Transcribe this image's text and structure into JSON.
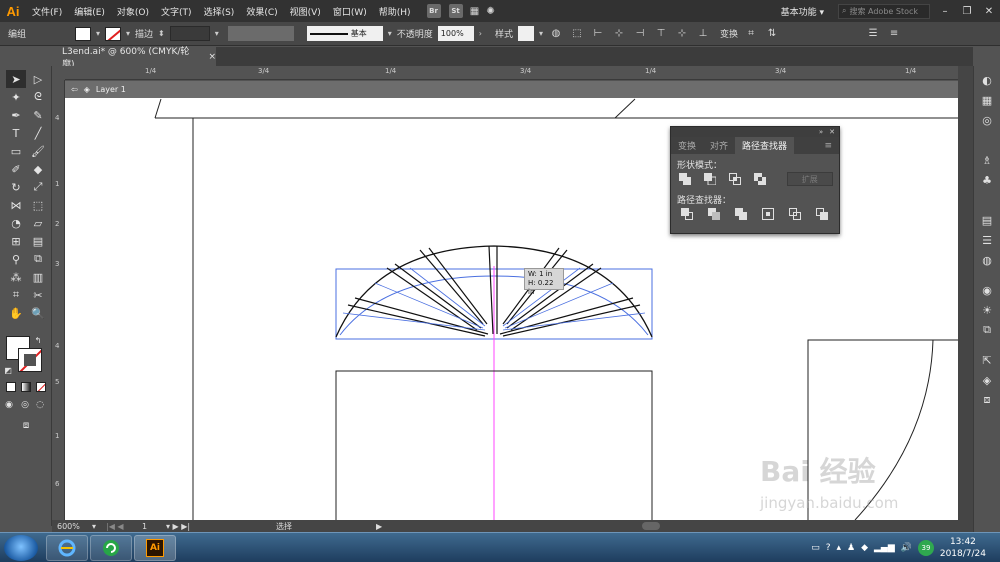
{
  "app": {
    "logo": "Ai",
    "workspace": "基本功能",
    "search_placeholder": "搜索 Adobe Stock"
  },
  "menu": [
    "文件(F)",
    "编辑(E)",
    "对象(O)",
    "文字(T)",
    "选择(S)",
    "效果(C)",
    "视图(V)",
    "窗口(W)",
    "帮助(H)"
  ],
  "menu_badges": [
    "Br",
    "St"
  ],
  "control": {
    "group_label": "编组",
    "stroke_label": "描边",
    "stroke_style": "基本",
    "opacity_label": "不透明度",
    "opacity_value": "100%",
    "style_label": "样式",
    "transform_label": "变换"
  },
  "document": {
    "tab_title": "L3end.ai* @ 600% (CMYK/轮廓)",
    "close": "×"
  },
  "layer": {
    "name": "Layer 1"
  },
  "ruler": {
    "top_labels": [
      "1/4",
      "1/4",
      "3/4",
      "1/4",
      "3/4",
      "1/4",
      "3/4"
    ],
    "left_labels": [
      "4",
      "1",
      "2",
      "3",
      "4",
      "5",
      "1",
      "6"
    ]
  },
  "pathfinder": {
    "tabs": [
      "变换",
      "对齐",
      "路径查找器"
    ],
    "active_tab": "路径查找器",
    "shape_modes_label": "形状模式：",
    "pathfinders_label": "路径查找器：",
    "expand_label": "扩展"
  },
  "tooltip": {
    "w": "W: 1 in",
    "h": "H: 0.22 in"
  },
  "status": {
    "zoom": "600%",
    "page": "1",
    "tool": "选择"
  },
  "taskbar": {
    "time": "13:42",
    "date": "2018/7/24",
    "badge": "39"
  },
  "watermark": {
    "brand": "Bai 经验",
    "url": "jingyan.baidu.com"
  },
  "colors": {
    "accent": "#ff9a00",
    "selection": "#4a6fe0",
    "guide": "#ff44ff"
  }
}
